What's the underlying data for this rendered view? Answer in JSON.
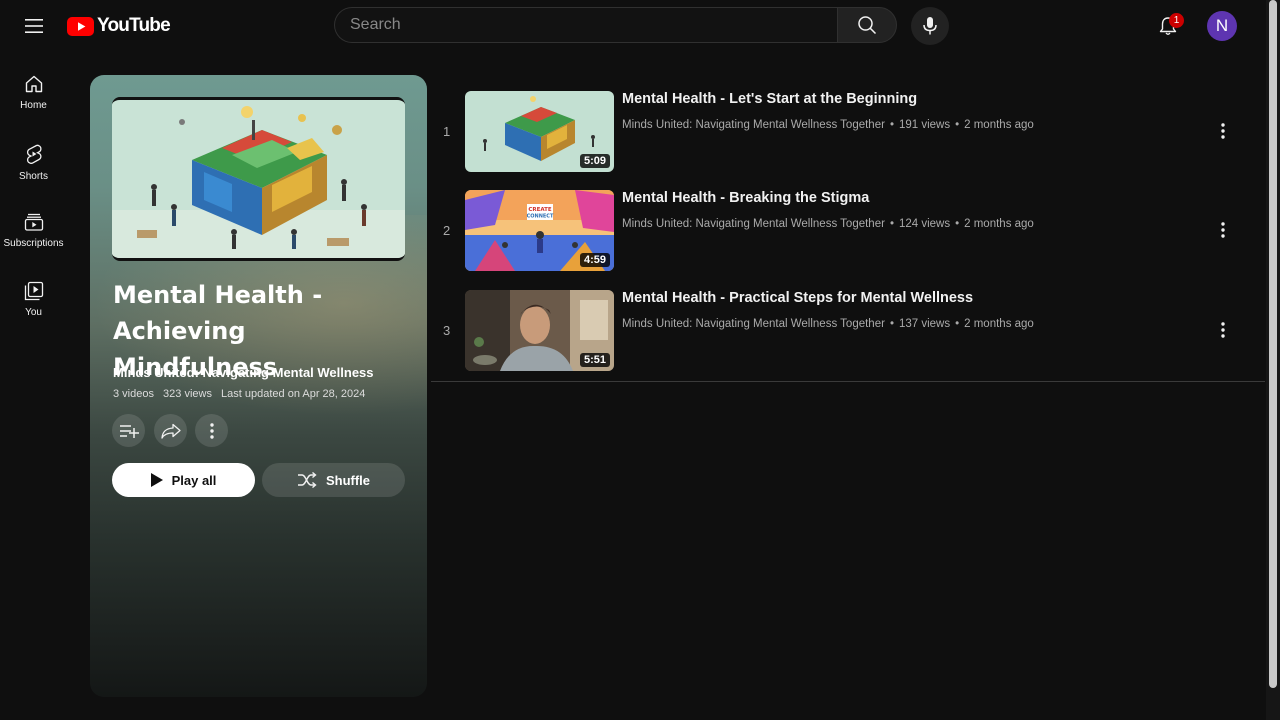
{
  "header": {
    "logo_text": "YouTube",
    "search_placeholder": "Search",
    "notification_count": "1",
    "avatar_letter": "N",
    "colors": {
      "brand_red": "#ff0000",
      "avatar_bg": "#5e35b1",
      "badge": "#cc0000"
    }
  },
  "sidebar": {
    "items": [
      {
        "label": "Home",
        "icon": "home-icon"
      },
      {
        "label": "Shorts",
        "icon": "shorts-icon"
      },
      {
        "label": "Subscriptions",
        "icon": "subscriptions-icon"
      },
      {
        "label": "You",
        "icon": "you-library-icon"
      }
    ]
  },
  "playlist": {
    "title": "Mental Health - Achieving Mindfulness",
    "channel": "Minds United: Navigating Mental Wellness",
    "video_count": "3 videos",
    "views": "323 views",
    "updated": "Last updated on Apr 28, 2024",
    "play_all_label": "Play all",
    "shuffle_label": "Shuffle"
  },
  "videos": [
    {
      "index": "1",
      "title": "Mental Health - Let's Start at the Beginning",
      "channel": "Minds United: Navigating Mental Wellness Together",
      "views": "191 views",
      "age": "2 months ago",
      "duration": "5:09"
    },
    {
      "index": "2",
      "title": "Mental Health - Breaking the Stigma",
      "channel": "Minds United: Navigating Mental Wellness Together",
      "views": "124 views",
      "age": "2 months ago",
      "duration": "4:59",
      "thumb_text": "CREATE CONNECT"
    },
    {
      "index": "3",
      "title": "Mental Health - Practical Steps for Mental Wellness",
      "channel": "Minds United: Navigating Mental Wellness Together",
      "views": "137 views",
      "age": "2 months ago",
      "duration": "5:51"
    }
  ],
  "separator": "•"
}
